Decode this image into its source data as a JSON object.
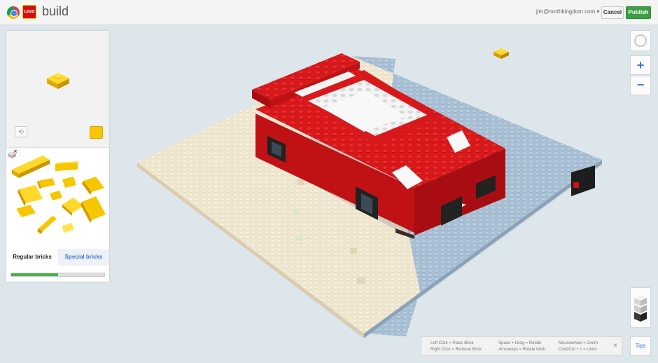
{
  "header": {
    "app_title": "build",
    "lego_logo_text": "LEGO",
    "account": "jim@northkingdom.com",
    "cancel_label": "Cancel",
    "publish_label": "Publish"
  },
  "panel": {
    "selected_color": "#f7c600",
    "tabs": [
      {
        "label": "Regular bricks",
        "active": true
      },
      {
        "label": "Special bricks",
        "active": false
      }
    ],
    "progress": 0.5
  },
  "controls": {
    "zoom_in": "+",
    "zoom_out": "−"
  },
  "tips": {
    "col1_line1": "Left Click = Place Brick",
    "col1_line2": "Right Click = Remove Brick",
    "col2_line1": "Space + Drag = Rotate",
    "col2_line2": "Arrowkeys = Rotate brick",
    "col3_line1": "Mousewheel = Zoom",
    "col3_line2": "Cmd/Ctrl + z = Undo",
    "close": "×",
    "button_label": "Tips"
  },
  "colors": {
    "brick_yellow": "#f7c600",
    "car_red": "#d8191c",
    "plate_cream": "#efe6cf",
    "plate_blue": "#a8bfd3",
    "accent_blue": "#3a78d6",
    "publish_green": "#3b9e42"
  },
  "icons": [
    "chrome-logo-icon",
    "lego-logo-icon",
    "rotate-icon",
    "delete-brick-icon",
    "compass-icon",
    "brick-stack-icon",
    "close-icon"
  ]
}
